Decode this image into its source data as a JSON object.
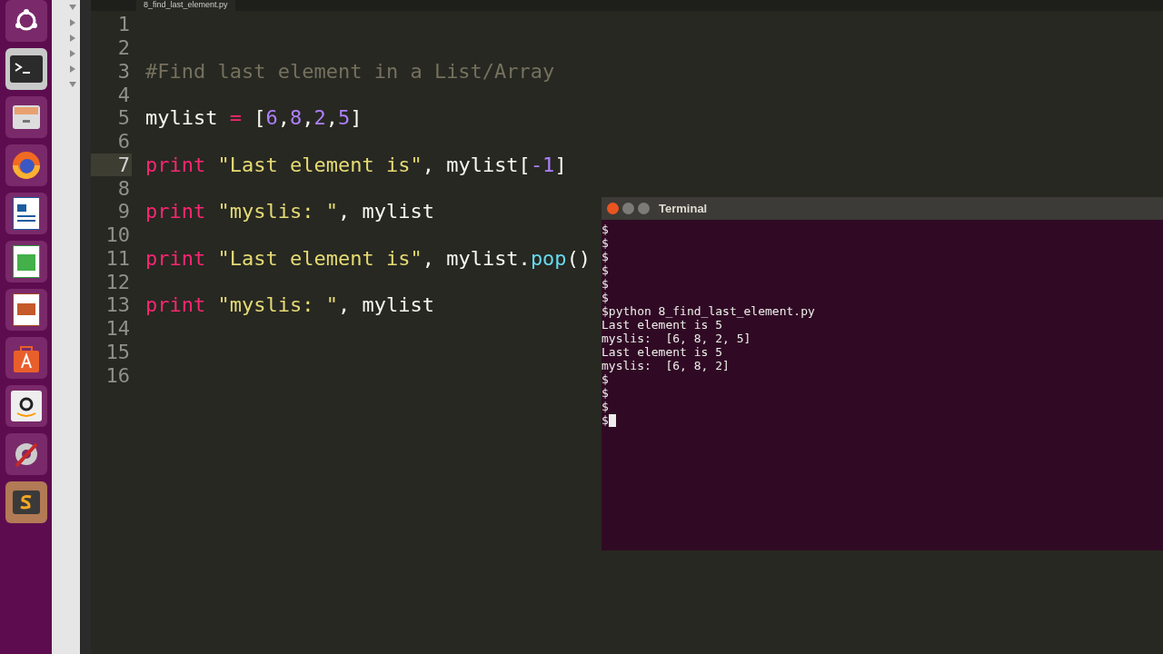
{
  "editor": {
    "tab_title": "8_find_last_element.py",
    "lines": [
      {
        "number": "1",
        "current": false
      },
      {
        "number": "2",
        "current": false
      },
      {
        "number": "3",
        "current": false,
        "tokens": [
          {
            "text": "#Find last element in a List/Array",
            "kind": "comment"
          }
        ]
      },
      {
        "number": "4",
        "current": false
      },
      {
        "number": "5",
        "current": false,
        "tokens": [
          {
            "text": "mylist ",
            "kind": "plain"
          },
          {
            "text": "=",
            "kind": "keyword"
          },
          {
            "text": " [",
            "kind": "plain"
          },
          {
            "text": "6",
            "kind": "number"
          },
          {
            "text": ",",
            "kind": "plain"
          },
          {
            "text": "8",
            "kind": "number"
          },
          {
            "text": ",",
            "kind": "plain"
          },
          {
            "text": "2",
            "kind": "number"
          },
          {
            "text": ",",
            "kind": "plain"
          },
          {
            "text": "5",
            "kind": "number"
          },
          {
            "text": "]",
            "kind": "plain"
          }
        ]
      },
      {
        "number": "6",
        "current": false
      },
      {
        "number": "7",
        "current": true,
        "tokens": [
          {
            "text": "print",
            "kind": "keyword"
          },
          {
            "text": " \"Last element is\"",
            "kind": "string"
          },
          {
            "text": ", mylist[",
            "kind": "plain"
          },
          {
            "text": "-1",
            "kind": "number"
          },
          {
            "text": "]",
            "kind": "plain"
          }
        ]
      },
      {
        "number": "8",
        "current": false
      },
      {
        "number": "9",
        "current": false,
        "tokens": [
          {
            "text": "print",
            "kind": "keyword"
          },
          {
            "text": " \"myslis: \"",
            "kind": "string"
          },
          {
            "text": ", mylist",
            "kind": "plain"
          }
        ]
      },
      {
        "number": "10",
        "current": false
      },
      {
        "number": "11",
        "current": false,
        "tokens": [
          {
            "text": "print",
            "kind": "keyword"
          },
          {
            "text": " \"Last element is\"",
            "kind": "string"
          },
          {
            "text": ", mylist.",
            "kind": "plain"
          },
          {
            "text": "pop",
            "kind": "function"
          },
          {
            "text": "()",
            "kind": "plain"
          }
        ]
      },
      {
        "number": "12",
        "current": false
      },
      {
        "number": "13",
        "current": false,
        "tokens": [
          {
            "text": "print",
            "kind": "keyword"
          },
          {
            "text": " \"myslis: \"",
            "kind": "string"
          },
          {
            "text": ", mylist",
            "kind": "plain"
          }
        ]
      },
      {
        "number": "14",
        "current": false
      },
      {
        "number": "15",
        "current": false
      },
      {
        "number": "16",
        "current": false
      }
    ]
  },
  "terminal": {
    "title": "Terminal",
    "lines": [
      "$",
      "$",
      "$",
      "$",
      "$",
      "$",
      "$python 8_find_last_element.py",
      "Last element is 5",
      "myslis:  [6, 8, 2, 5]",
      "Last element is 5",
      "myslis:  [6, 8, 2]",
      "$",
      "$",
      "$",
      "$"
    ]
  }
}
